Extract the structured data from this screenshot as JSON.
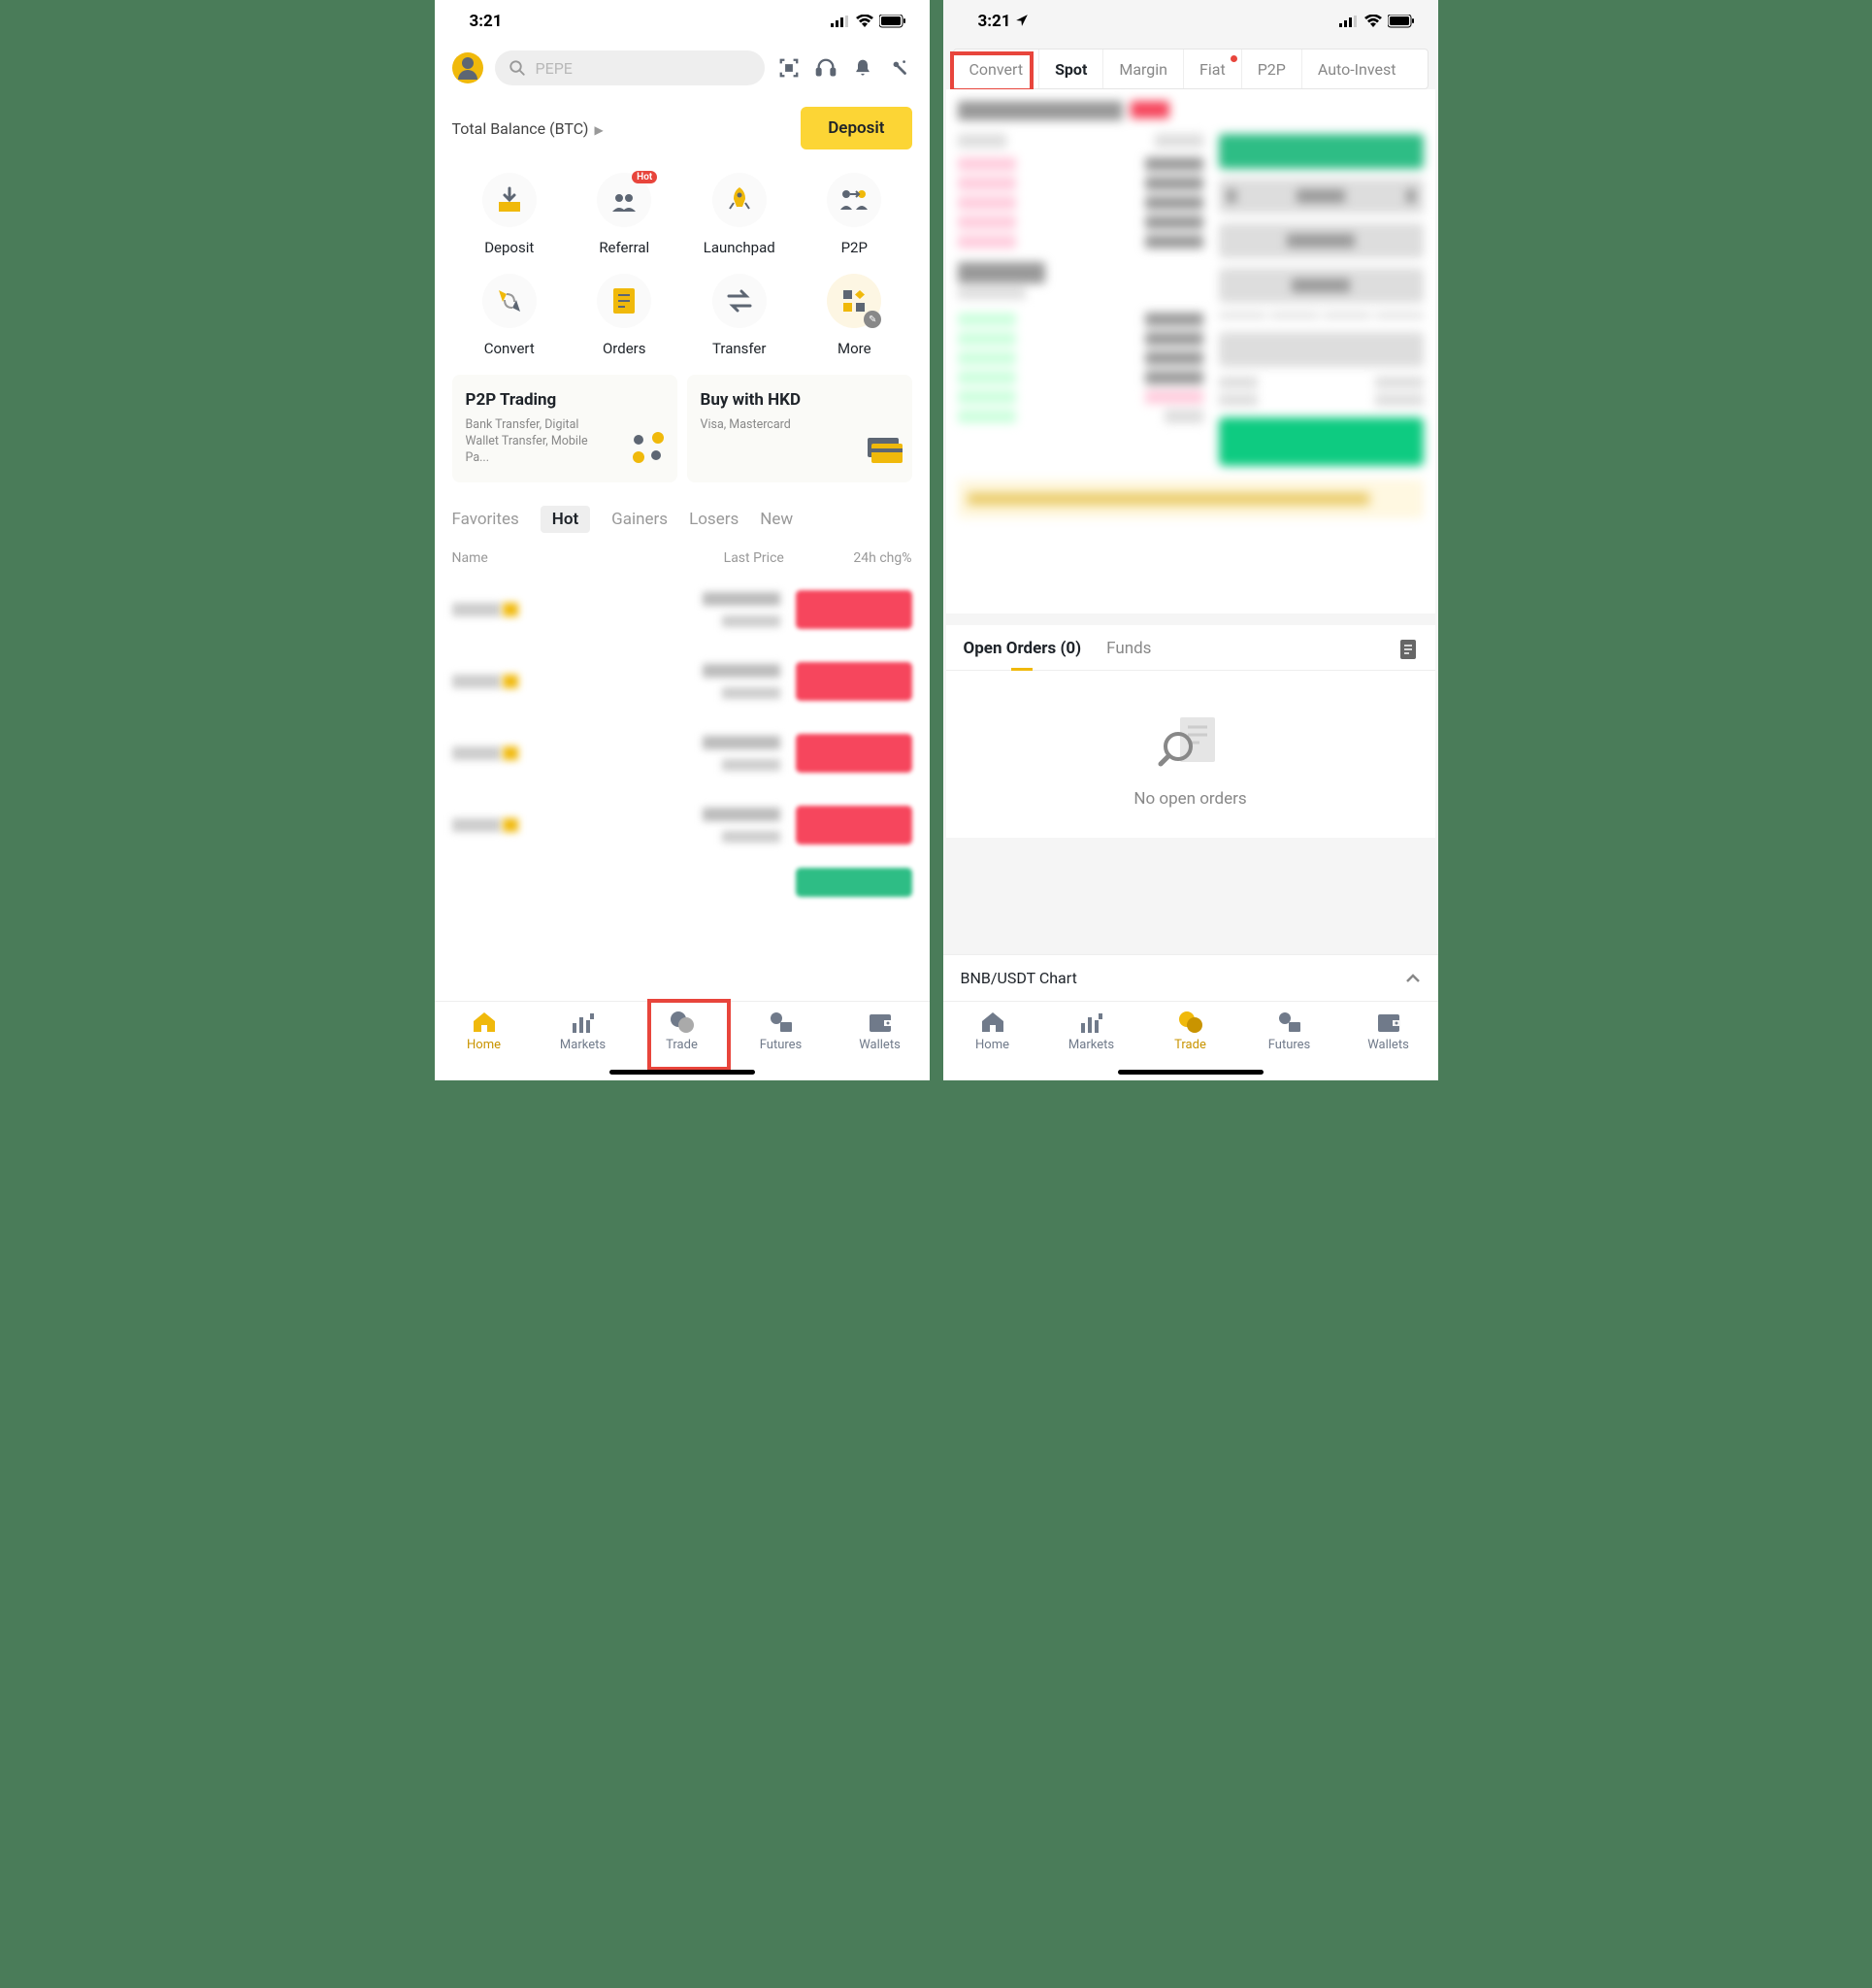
{
  "status": {
    "time": "3:21"
  },
  "left": {
    "search_placeholder": "PEPE",
    "balance_label": "Total Balance (BTC)",
    "deposit_btn": "Deposit",
    "shortcuts": [
      {
        "label": "Deposit"
      },
      {
        "label": "Referral",
        "badge": "Hot"
      },
      {
        "label": "Launchpad"
      },
      {
        "label": "P2P"
      },
      {
        "label": "Convert"
      },
      {
        "label": "Orders"
      },
      {
        "label": "Transfer"
      },
      {
        "label": "More"
      }
    ],
    "promo": [
      {
        "title": "P2P Trading",
        "sub": "Bank Transfer, Digital Wallet Transfer, Mobile Pa..."
      },
      {
        "title": "Buy with HKD",
        "sub": "Visa, Mastercard"
      }
    ],
    "market_tabs": [
      "Favorites",
      "Hot",
      "Gainers",
      "Losers",
      "New"
    ],
    "market_tab_active": "Hot",
    "market_header": {
      "name": "Name",
      "price": "Last Price",
      "chg": "24h chg%"
    }
  },
  "right": {
    "trade_tabs": [
      "Convert",
      "Spot",
      "Margin",
      "Fiat",
      "P2P",
      "Auto-Invest"
    ],
    "trade_tab_active": "Spot",
    "highlighted_tab": "Convert",
    "orders_tabs": {
      "open": "Open Orders (0)",
      "funds": "Funds"
    },
    "empty_text": "No open orders",
    "chart_label": "BNB/USDT Chart"
  },
  "nav": [
    "Home",
    "Markets",
    "Trade",
    "Futures",
    "Wallets"
  ]
}
